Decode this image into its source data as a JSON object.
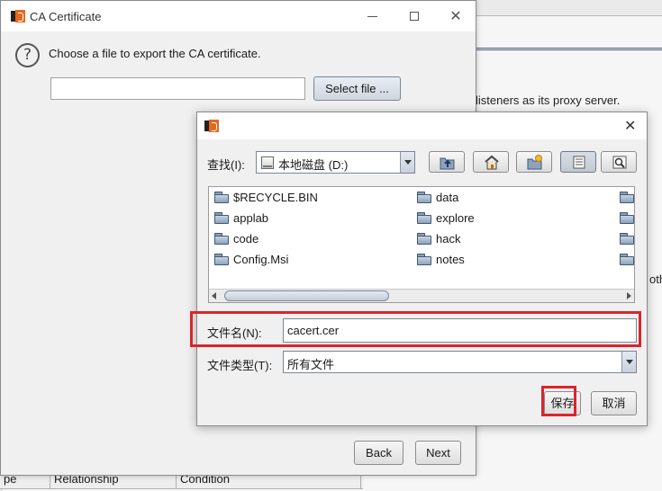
{
  "background": {
    "right_text": "listeners as its proxy server.",
    "right_text_2": "oth",
    "table_headers": [
      "pe",
      "Relationship",
      "Condition"
    ]
  },
  "wizard": {
    "title": "CA Certificate",
    "prompt": "Choose a file to export the CA certificate.",
    "file_value": "",
    "select_button": "Select file ...",
    "back_button": "Back",
    "next_button": "Next"
  },
  "chooser": {
    "look_in_label": "查找(I):",
    "look_in_value": "本地磁盘 (D:)",
    "files": [
      {
        "name": "$RECYCLE.BIN"
      },
      {
        "name": "applab"
      },
      {
        "name": "code"
      },
      {
        "name": "Config.Msi"
      },
      {
        "name": "data"
      },
      {
        "name": "explore"
      },
      {
        "name": "hack"
      },
      {
        "name": "notes"
      }
    ],
    "filename_label": "文件名(N):",
    "filename_value": "cacert.cer",
    "filetype_label": "文件类型(T):",
    "filetype_value": "所有文件",
    "save_button": "保存",
    "cancel_button": "取消"
  },
  "icons": {
    "app": "burp-logo-icon",
    "prompt": "question-icon",
    "toolbar": [
      "up-folder-icon",
      "home-icon",
      "new-folder-icon",
      "list-view-icon",
      "details-view-icon"
    ]
  },
  "colors": {
    "highlight": "#d9262c",
    "accent": "#e8671e"
  }
}
